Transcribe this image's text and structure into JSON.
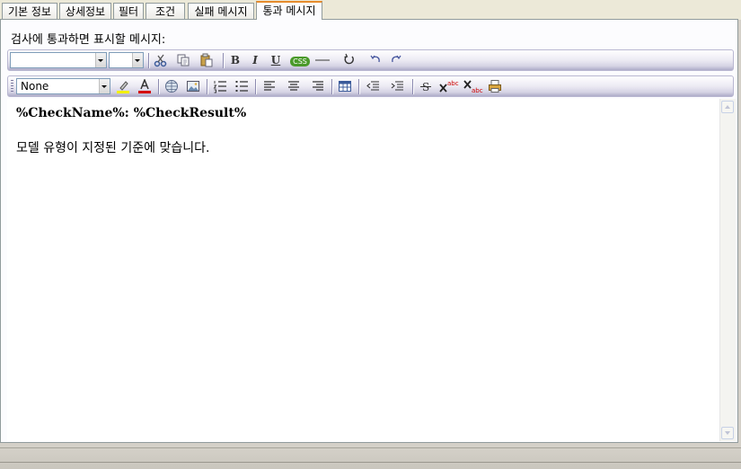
{
  "tabs": [
    {
      "label": "기본 정보"
    },
    {
      "label": "상세정보"
    },
    {
      "label": "필터"
    },
    {
      "label": "조건"
    },
    {
      "label": "실패 메시지"
    },
    {
      "label": "통과 메시지"
    }
  ],
  "active_tab": "통과 메시지",
  "caption": "검사에 통과하면 표시할 메시지:",
  "toolbar1": {
    "font_name": "",
    "font_size": "",
    "bold": "B",
    "italic": "I",
    "underline": "U",
    "css": "CSS"
  },
  "toolbar2": {
    "style": "None"
  },
  "editor": {
    "heading": "%CheckName%: %CheckResult%",
    "body": "모델 유형이 지정된 기준에 맞습니다."
  },
  "colors": {
    "active_tab_accent": "#e68b2c",
    "toolbar_tint": "#d5d3e4",
    "css_badge": "#4a9a2a",
    "highlight_color": "#f3f000",
    "font_color": "#d40000"
  }
}
